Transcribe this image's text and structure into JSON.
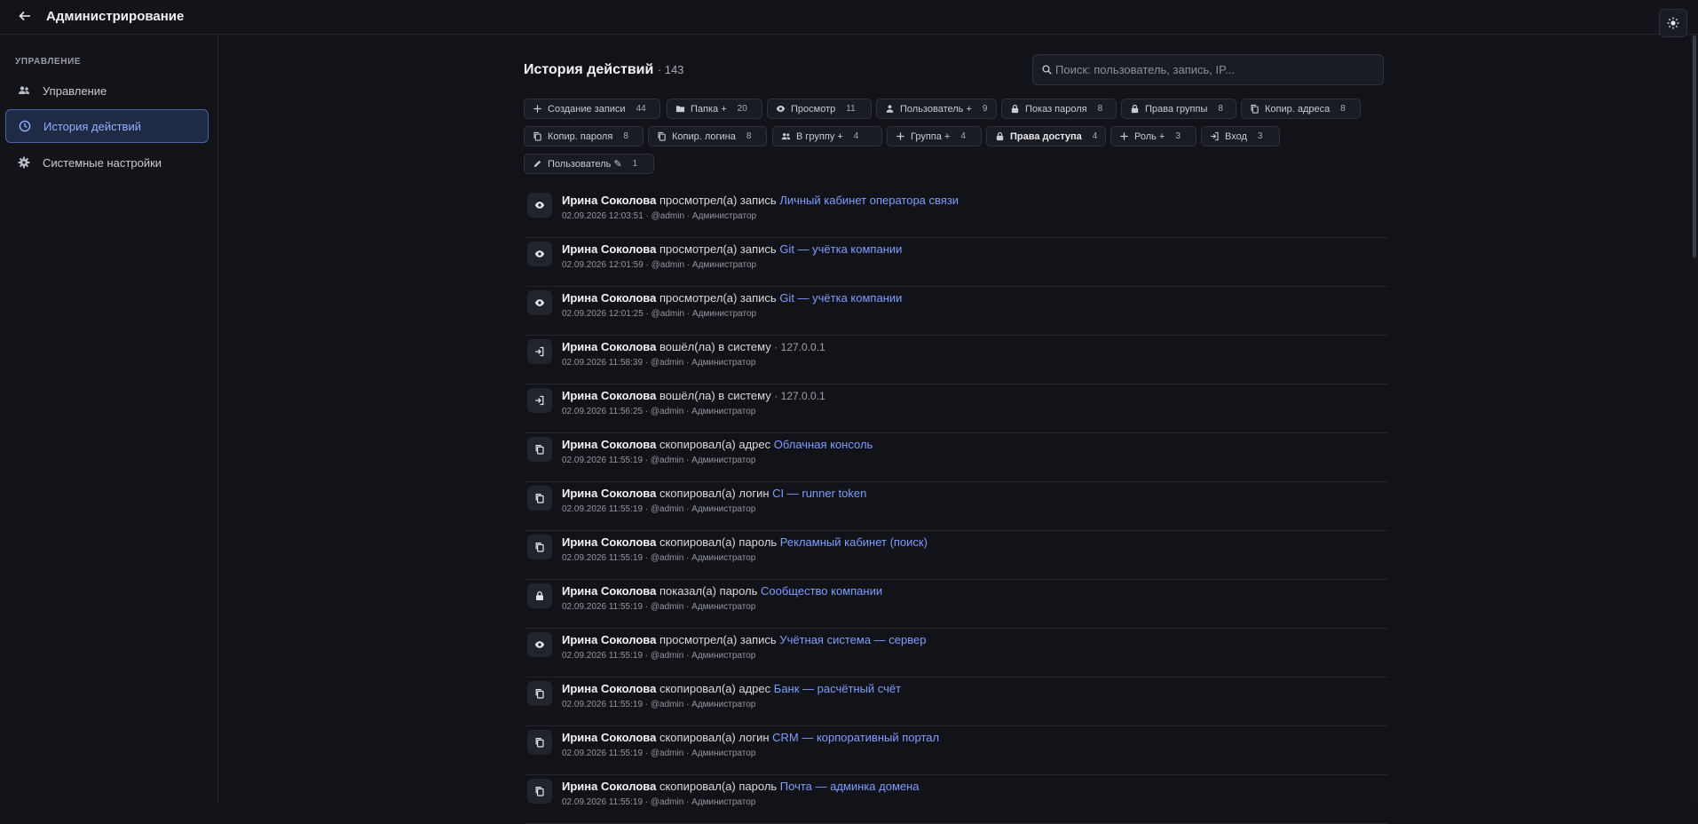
{
  "header": {
    "title": "Администрирование",
    "back_icon": "arrow-left-icon",
    "theme_icon": "sun-icon"
  },
  "sidebar": {
    "heading": "УПРАВЛЕНИЕ",
    "items": [
      {
        "label": "Управление",
        "icon": "users-icon",
        "active": false
      },
      {
        "label": "История действий",
        "icon": "clock-icon",
        "active": true
      },
      {
        "label": "Системные настройки",
        "icon": "gear-icon",
        "active": false
      }
    ]
  },
  "main": {
    "title": "История действий",
    "count": "· 143",
    "search": {
      "placeholder": "Поиск: пользователь, запись, IP...",
      "value": "",
      "icon": "search-icon"
    },
    "filters": [
      {
        "label": "Создание записи",
        "count": "44",
        "icon": "plus-icon"
      },
      {
        "label": "Папка +",
        "count": "20",
        "icon": "folder-icon"
      },
      {
        "label": "Просмотр",
        "count": "11",
        "icon": "eye-icon"
      },
      {
        "label": "Пользователь +",
        "count": "9",
        "icon": "person-icon"
      },
      {
        "label": "Показ пароля",
        "count": "8",
        "icon": "lock-icon"
      },
      {
        "label": "Права группы",
        "count": "8",
        "icon": "lock-icon"
      },
      {
        "label": "Копир. адреса",
        "count": "8",
        "icon": "copy-icon"
      },
      {
        "label": "Копир. пароля",
        "count": "8",
        "icon": "copy-icon"
      },
      {
        "label": "Копир. логина",
        "count": "8",
        "icon": "copy-icon"
      },
      {
        "label": "В группу +",
        "count": "4",
        "icon": "group-icon"
      },
      {
        "label": "Группа +",
        "count": "4",
        "icon": "plus-icon"
      },
      {
        "label": "Права доступа",
        "count": "4",
        "icon": "lock-icon"
      },
      {
        "label": "Роль +",
        "count": "3",
        "icon": "plus-icon"
      },
      {
        "label": "Вход",
        "count": "3",
        "icon": "login-icon"
      },
      {
        "label": "Пользователь ✎",
        "count": "1",
        "icon": "pencil-icon"
      }
    ],
    "events": [
      {
        "icon": "eye-icon",
        "user": "Ирина Соколова",
        "action": "просмотрел(а) запись",
        "target": "Личный кабинет оператора связи",
        "ip": "",
        "meta": "02.09.2026 12:03:51 · @admin · Администратор"
      },
      {
        "icon": "eye-icon",
        "user": "Ирина Соколова",
        "action": "просмотрел(а) запись",
        "target": "Git — учётка компании",
        "ip": "",
        "meta": "02.09.2026 12:01:59 · @admin · Администратор"
      },
      {
        "icon": "eye-icon",
        "user": "Ирина Соколова",
        "action": "просмотрел(а) запись",
        "target": "Git — учётка компании",
        "ip": "",
        "meta": "02.09.2026 12:01:25 · @admin · Администратор"
      },
      {
        "icon": "login-icon",
        "user": "Ирина Соколова",
        "action": "вошёл(ла) в систему",
        "target": "",
        "ip": "· 127.0.0.1",
        "meta": "02.09.2026 11:58:39 · @admin · Администратор"
      },
      {
        "icon": "login-icon",
        "user": "Ирина Соколова",
        "action": "вошёл(ла) в систему",
        "target": "",
        "ip": "· 127.0.0.1",
        "meta": "02.09.2026 11:56:25 · @admin · Администратор"
      },
      {
        "icon": "copy-icon",
        "user": "Ирина Соколова",
        "action": "скопировал(а) адрес",
        "target": "Облачная консоль",
        "ip": "",
        "meta": "02.09.2026 11:55:19 · @admin · Администратор"
      },
      {
        "icon": "copy-icon",
        "user": "Ирина Соколова",
        "action": "скопировал(а) логин",
        "target": "CI — runner token",
        "ip": "",
        "meta": "02.09.2026 11:55:19 · @admin · Администратор"
      },
      {
        "icon": "copy-icon",
        "user": "Ирина Соколова",
        "action": "скопировал(а) пароль",
        "target": "Рекламный кабинет (поиск)",
        "ip": "",
        "meta": "02.09.2026 11:55:19 · @admin · Администратор"
      },
      {
        "icon": "lock-icon",
        "user": "Ирина Соколова",
        "action": "показал(а) пароль",
        "target": "Сообщество компании",
        "ip": "",
        "meta": "02.09.2026 11:55:19 · @admin · Администратор"
      },
      {
        "icon": "eye-icon",
        "user": "Ирина Соколова",
        "action": "просмотрел(а) запись",
        "target": "Учётная система — сервер",
        "ip": "",
        "meta": "02.09.2026 11:55:19 · @admin · Администратор"
      },
      {
        "icon": "copy-icon",
        "user": "Ирина Соколова",
        "action": "скопировал(а) адрес",
        "target": "Банк — расчётный счёт",
        "ip": "",
        "meta": "02.09.2026 11:55:19 · @admin · Администратор"
      },
      {
        "icon": "copy-icon",
        "user": "Ирина Соколова",
        "action": "скопировал(а) логин",
        "target": "CRM — корпоративный портал",
        "ip": "",
        "meta": "02.09.2026 11:55:19 · @admin · Администратор"
      },
      {
        "icon": "copy-icon",
        "user": "Ирина Соколова",
        "action": "скопировал(а) пароль",
        "target": "Почта — админка домена",
        "ip": "",
        "meta": "02.09.2026 11:55:19 · @admin · Администратор"
      }
    ]
  }
}
